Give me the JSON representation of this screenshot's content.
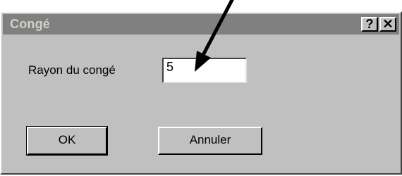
{
  "window": {
    "title": "Congé",
    "help_label": "?",
    "close_label": "✕",
    "help_icon": "question-mark-icon",
    "close_icon": "close-icon"
  },
  "form": {
    "radius_label": "Rayon du congé",
    "radius_value": "5"
  },
  "buttons": {
    "ok_label": "OK",
    "cancel_label": "Annuler"
  },
  "annotation": {
    "icon": "arrow-annotation",
    "color": "#000000"
  },
  "colors": {
    "dialog_bg": "#c0c0c0",
    "titlebar_inactive": "#808080"
  }
}
